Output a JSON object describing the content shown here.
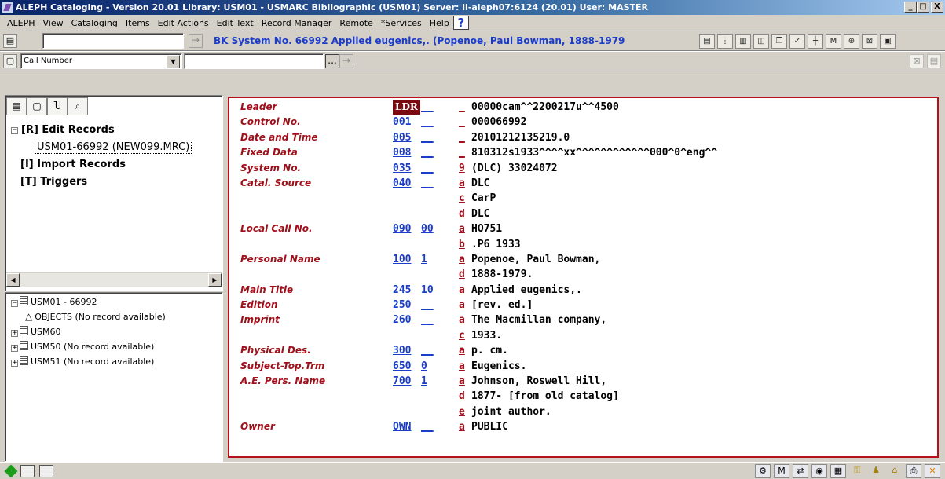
{
  "window": {
    "title": "ALEPH Cataloging - Version 20.01  Library:  USM01 - USMARC Bibliographic (USM01)  Server:  il-aleph07:6124 (20.01)  User:  MASTER",
    "minimize": "_",
    "maximize": "□",
    "close": "X"
  },
  "menu": {
    "items": [
      "ALEPH",
      "View",
      "Cataloging",
      "Items",
      "Edit Actions",
      "Edit Text",
      "Record Manager",
      "Remote",
      "*Services",
      "Help"
    ],
    "help_icon": "?"
  },
  "toolbar1": {
    "input_value": "",
    "go_arrow": "→",
    "record_info": "BK System No. 66992 Applied eugenics,. (Popenoe, Paul Bowman, 1888-1979"
  },
  "toolbar2": {
    "search_type": "Call Number",
    "search_value": "",
    "ellipsis": "...",
    "go_arrow": "→"
  },
  "left_tabs": [
    "record-tab",
    "item-tab",
    "tools-tab",
    "search-tab"
  ],
  "tree_top": [
    {
      "toggle": "−",
      "label": "[R] Edit Records"
    },
    {
      "label": "USM01-66992 (NEW099.MRC)"
    },
    {
      "label": "[I] Import Records"
    },
    {
      "label": "[T] Triggers"
    }
  ],
  "tree_bottom": [
    {
      "toggle": "−",
      "label": "USM01 - 66992"
    },
    {
      "label": "OBJECTS (No record available)"
    },
    {
      "toggle": "+",
      "label": "USM60"
    },
    {
      "toggle": "+",
      "label": "USM50 (No record available)"
    },
    {
      "toggle": "+",
      "label": "USM51 (No record available)"
    }
  ],
  "record": [
    {
      "label": "Leader",
      "tag": "LDR",
      "ind": "__",
      "sub": "_",
      "value": "00000cam^^2200217u^^4500"
    },
    {
      "label": "Control No.",
      "tag": "001",
      "ind": "__",
      "sub": "_",
      "value": "000066992"
    },
    {
      "label": "Date and Time",
      "tag": "005",
      "ind": "__",
      "sub": "_",
      "value": "20101212135219.0"
    },
    {
      "label": "Fixed Data",
      "tag": "008",
      "ind": "__",
      "sub": "_",
      "value": "810312s1933^^^^xx^^^^^^^^^^^^000^0^eng^^"
    },
    {
      "label": "System No.",
      "tag": "035",
      "ind": "__",
      "sub": "9",
      "value": "(DLC) 33024072"
    },
    {
      "label": "Catal. Source",
      "tag": "040",
      "ind": "__",
      "sub": "a",
      "value": "DLC"
    },
    {
      "label": "",
      "tag": "",
      "ind": "",
      "sub": "c",
      "value": "CarP"
    },
    {
      "label": "",
      "tag": "",
      "ind": "",
      "sub": "d",
      "value": "DLC"
    },
    {
      "label": "Local Call No.",
      "tag": "090",
      "ind": "00",
      "sub": "a",
      "value": "HQ751"
    },
    {
      "label": "",
      "tag": "",
      "ind": "",
      "sub": "b",
      "value": ".P6 1933"
    },
    {
      "label": "Personal Name",
      "tag": "100",
      "ind": "1 ",
      "sub": "a",
      "value": "Popenoe, Paul Bowman,"
    },
    {
      "label": "",
      "tag": "",
      "ind": "",
      "sub": "d",
      "value": "1888-1979."
    },
    {
      "label": "Main Title",
      "tag": "245",
      "ind": "10",
      "sub": "a",
      "value": "Applied eugenics,."
    },
    {
      "label": "Edition",
      "tag": "250",
      "ind": "__",
      "sub": "a",
      "value": "[rev. ed.]"
    },
    {
      "label": "Imprint",
      "tag": "260",
      "ind": "__",
      "sub": "a",
      "value": "The Macmillan company,"
    },
    {
      "label": "",
      "tag": "",
      "ind": "",
      "sub": "c",
      "value": "1933."
    },
    {
      "label": "Physical Des.",
      "tag": "300",
      "ind": "__",
      "sub": "a",
      "value": "p. cm."
    },
    {
      "label": "Subject-Top.Trm",
      "tag": "650",
      "ind": " 0",
      "sub": "a",
      "value": "Eugenics."
    },
    {
      "label": "A.E. Pers. Name",
      "tag": "700",
      "ind": "1 ",
      "sub": "a",
      "value": "Johnson, Roswell Hill,"
    },
    {
      "label": "",
      "tag": "",
      "ind": "",
      "sub": "d",
      "value": "1877- [from old catalog]"
    },
    {
      "label": "",
      "tag": "",
      "ind": "",
      "sub": "e",
      "value": "joint author."
    },
    {
      "label": "Owner",
      "tag": "OWN",
      "ind": "__",
      "sub": "a",
      "value": "PUBLIC"
    }
  ],
  "colors": {
    "label": "#a0101a",
    "tag": "#1a3cc8",
    "border": "#b8101a",
    "leader_bg": "#7a0a10"
  }
}
